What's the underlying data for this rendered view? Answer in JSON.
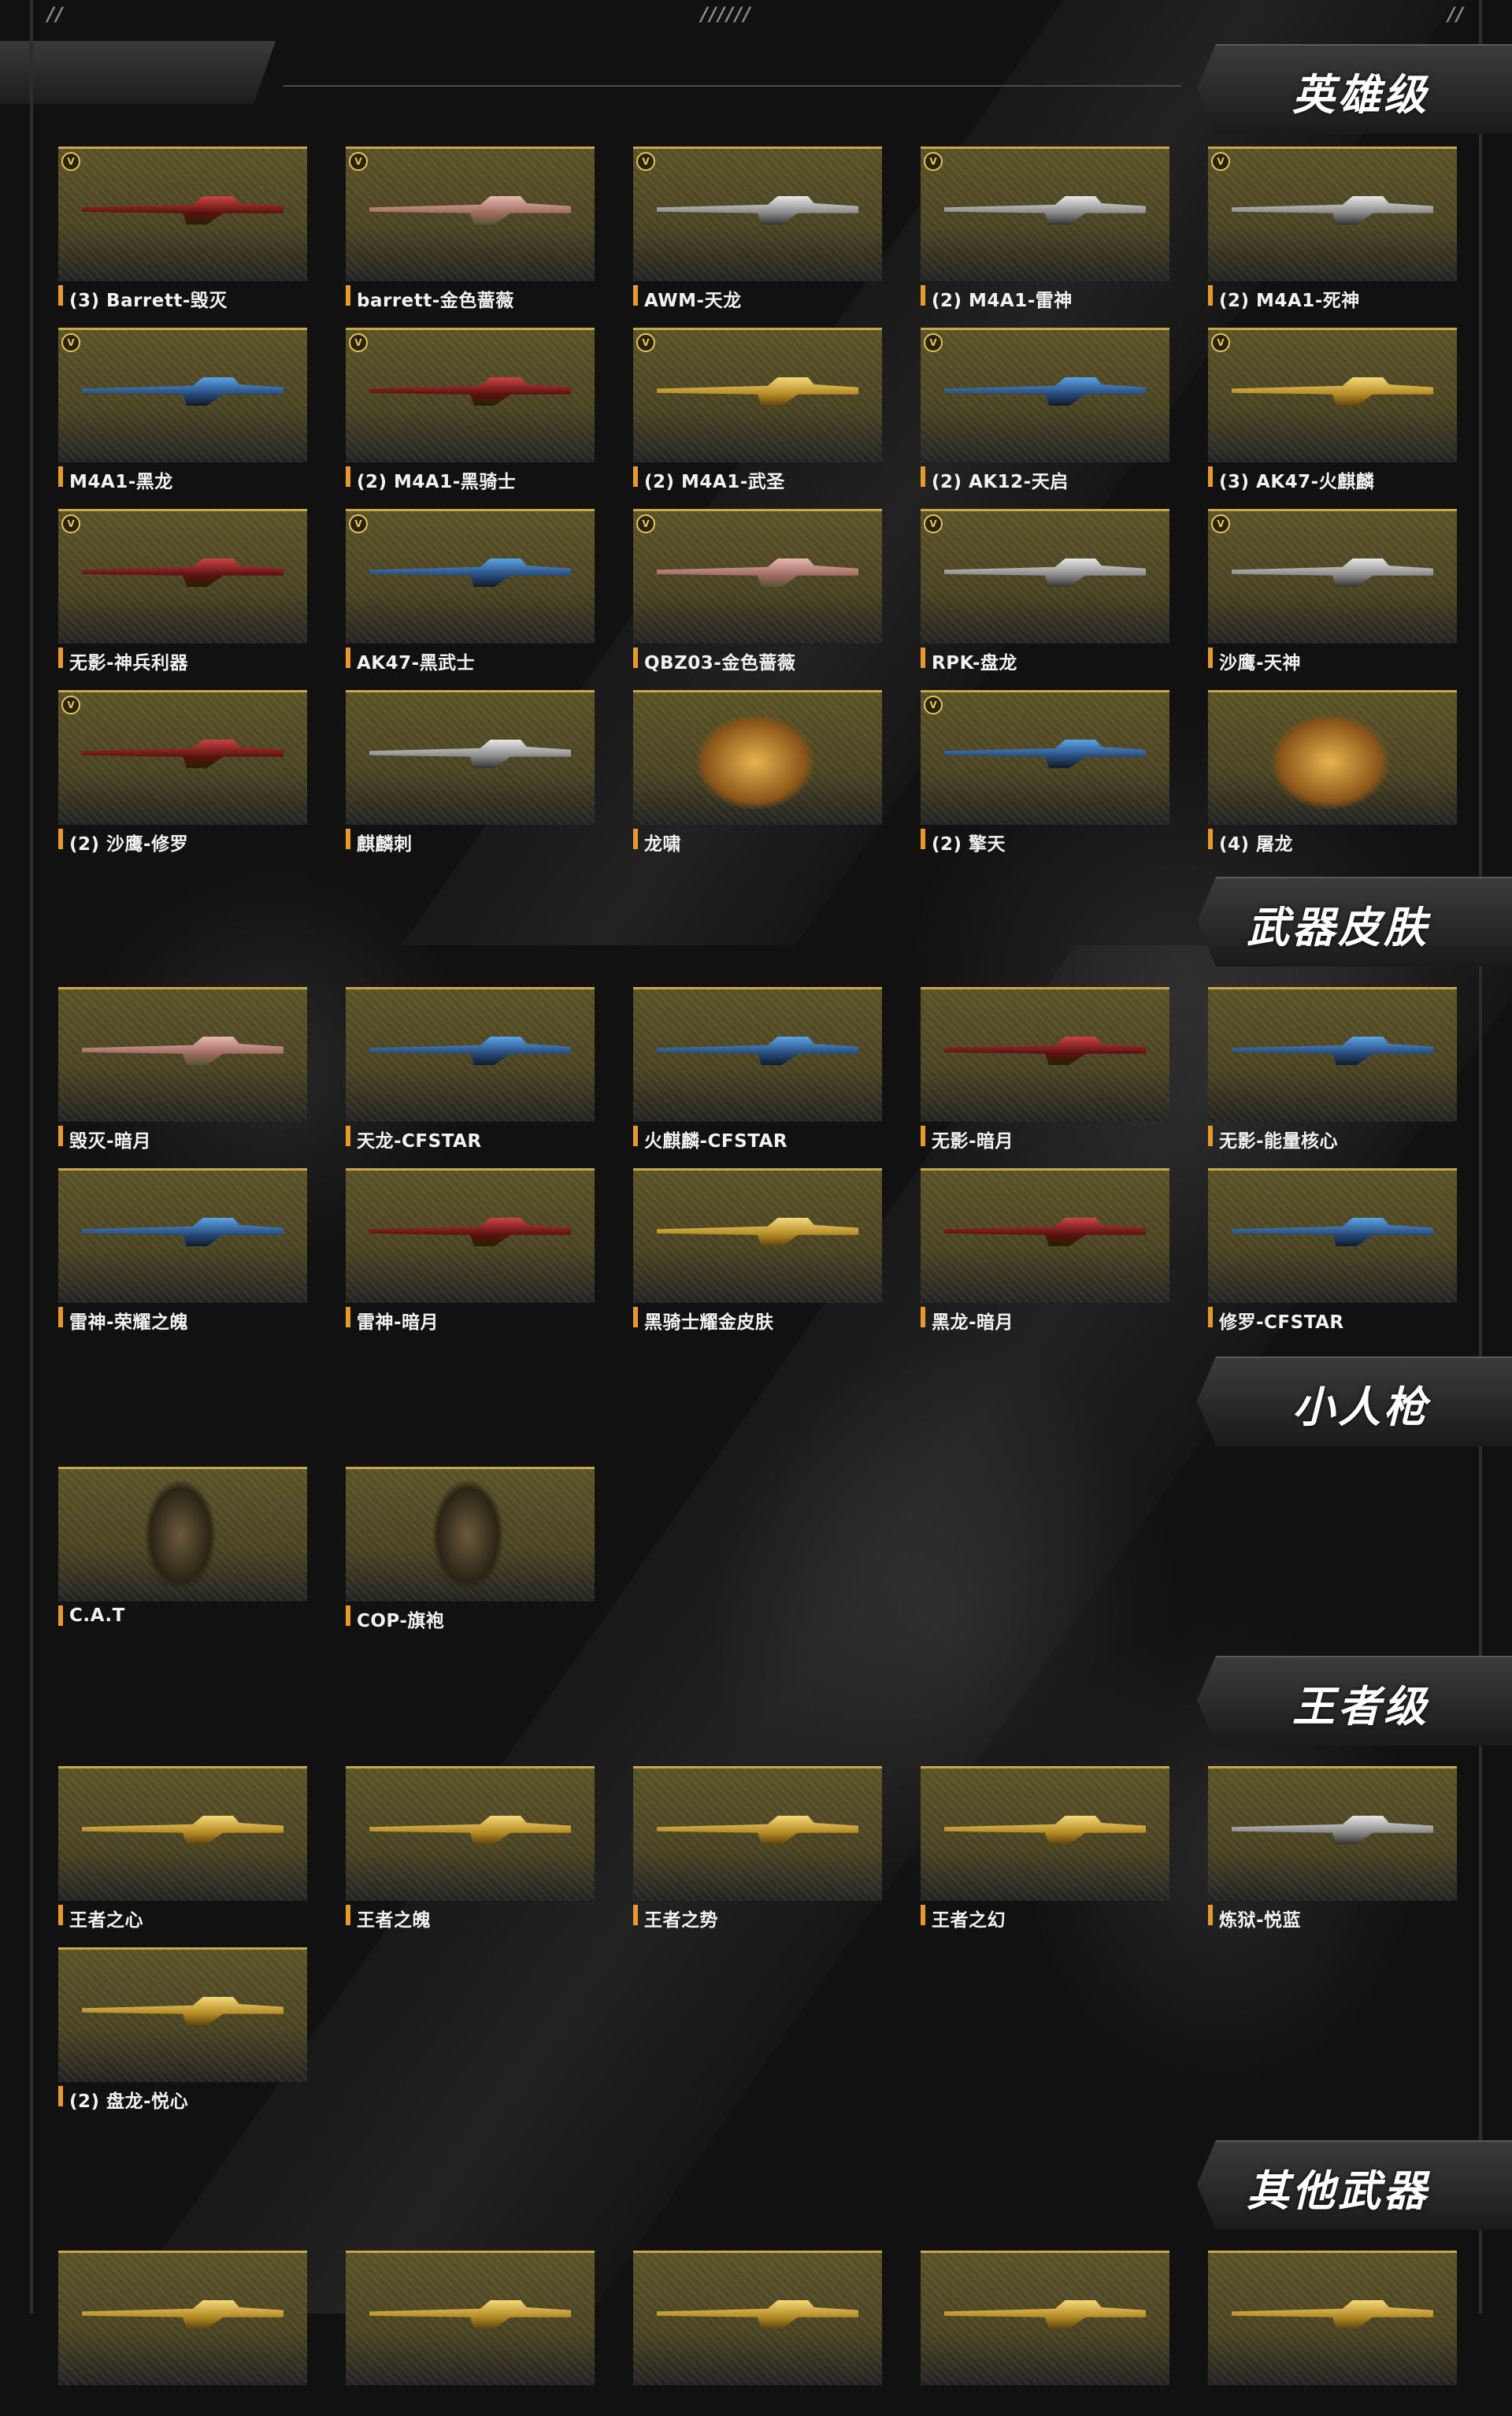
{
  "top_marks": [
    "//",
    "//////",
    "//"
  ],
  "sections": [
    {
      "title": "英雄级",
      "items": [
        {
          "label": "(3) Barrett-毁灭",
          "style": "red",
          "badge": true
        },
        {
          "label": "barrett-金色蔷薇",
          "style": "pink",
          "badge": true
        },
        {
          "label": "AWM-天龙",
          "style": "silver",
          "badge": true
        },
        {
          "label": "(2) M4A1-雷神",
          "style": "silver",
          "badge": true
        },
        {
          "label": "(2) M4A1-死神",
          "style": "silver",
          "badge": true
        },
        {
          "label": "M4A1-黑龙",
          "style": "blue",
          "badge": true
        },
        {
          "label": "(2) M4A1-黑骑士",
          "style": "red",
          "badge": true
        },
        {
          "label": "(2) M4A1-武圣",
          "style": "gold",
          "badge": true
        },
        {
          "label": "(2) AK12-天启",
          "style": "blue",
          "badge": true
        },
        {
          "label": "(3) AK47-火麒麟",
          "style": "gold",
          "badge": true
        },
        {
          "label": "无影-神兵利器",
          "style": "red",
          "badge": true
        },
        {
          "label": "AK47-黑武士",
          "style": "blue",
          "badge": true
        },
        {
          "label": "QBZ03-金色蔷薇",
          "style": "pink",
          "badge": true
        },
        {
          "label": "RPK-盘龙",
          "style": "silver",
          "badge": true
        },
        {
          "label": "沙鹰-天神",
          "style": "silver",
          "badge": true
        },
        {
          "label": "(2) 沙鹰-修罗",
          "style": "red",
          "badge": true
        },
        {
          "label": "麒麟刺",
          "style": "silver",
          "badge": false
        },
        {
          "label": "龙啸",
          "style": "melee",
          "badge": false
        },
        {
          "label": "(2) 擎天",
          "style": "blue",
          "badge": true
        },
        {
          "label": "(4) 屠龙",
          "style": "melee",
          "badge": false
        }
      ]
    },
    {
      "title": "武器皮肤",
      "items": [
        {
          "label": "毁灭-暗月",
          "style": "pink",
          "badge": false
        },
        {
          "label": "天龙-CFSTAR",
          "style": "blue",
          "badge": false
        },
        {
          "label": "火麒麟-CFSTAR",
          "style": "blue",
          "badge": false
        },
        {
          "label": "无影-暗月",
          "style": "red",
          "badge": false
        },
        {
          "label": "无影-能量核心",
          "style": "blue",
          "badge": false
        },
        {
          "label": "雷神-荣耀之魄",
          "style": "blue",
          "badge": false
        },
        {
          "label": "雷神-暗月",
          "style": "red",
          "badge": false
        },
        {
          "label": "黑骑士耀金皮肤",
          "style": "gold",
          "badge": false
        },
        {
          "label": "黑龙-暗月",
          "style": "red",
          "badge": false
        },
        {
          "label": "修罗-CFSTAR",
          "style": "blue",
          "badge": false
        }
      ]
    },
    {
      "title": "小人枪",
      "items": [
        {
          "label": "C.A.T",
          "style": "figure",
          "badge": false
        },
        {
          "label": "COP-旗袍",
          "style": "figure",
          "badge": false
        }
      ]
    },
    {
      "title": "王者级",
      "items": [
        {
          "label": "王者之心",
          "style": "gold",
          "badge": false
        },
        {
          "label": "王者之魄",
          "style": "gold",
          "badge": false
        },
        {
          "label": "王者之势",
          "style": "gold",
          "badge": false
        },
        {
          "label": "王者之幻",
          "style": "gold",
          "badge": false
        },
        {
          "label": "炼狱-悦蓝",
          "style": "silver",
          "badge": false
        },
        {
          "label": "(2) 盘龙-悦心",
          "style": "gold",
          "badge": false
        }
      ]
    },
    {
      "title": "其他武器",
      "items": [
        {
          "label": "",
          "style": "gold",
          "badge": false
        },
        {
          "label": "",
          "style": "gold",
          "badge": false
        },
        {
          "label": "",
          "style": "gold",
          "badge": false
        },
        {
          "label": "",
          "style": "gold",
          "badge": false
        },
        {
          "label": "",
          "style": "gold",
          "badge": false
        }
      ]
    }
  ]
}
